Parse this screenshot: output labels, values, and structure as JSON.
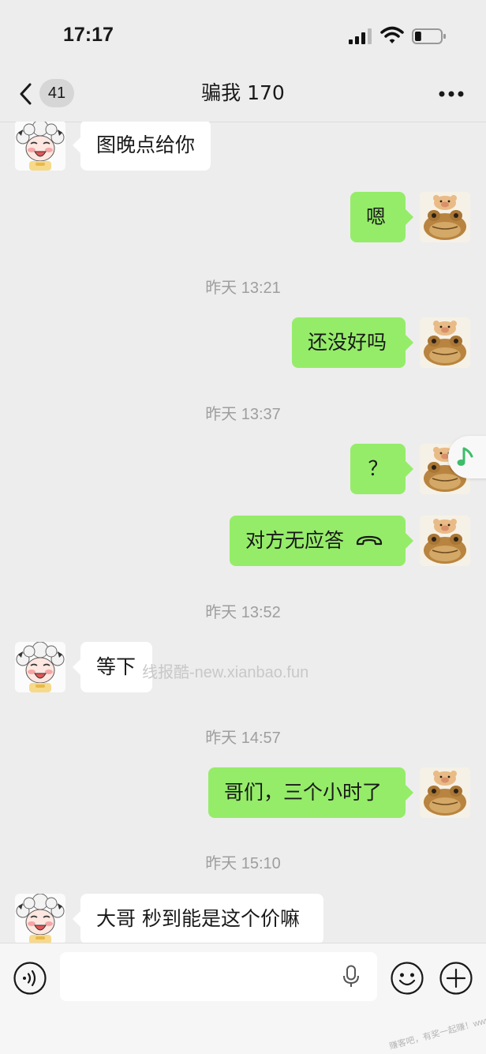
{
  "status_bar": {
    "time": "17:17",
    "battery_level": 0.25
  },
  "header": {
    "back_badge": "41",
    "title": "骗我 170"
  },
  "messages": [
    {
      "type": "text",
      "side": "in",
      "text": "图晚点给你",
      "avatar": "sheep-avatar-icon"
    },
    {
      "type": "text",
      "side": "out",
      "text": "嗯",
      "avatar": "toad-avatar-icon"
    },
    {
      "type": "time",
      "text": "昨天 13:21"
    },
    {
      "type": "text",
      "side": "out",
      "text": "还没好吗",
      "avatar": "toad-avatar-icon"
    },
    {
      "type": "time",
      "text": "昨天 13:37"
    },
    {
      "type": "text",
      "side": "out",
      "text": "？",
      "avatar": "toad-avatar-icon"
    },
    {
      "type": "call",
      "side": "out",
      "text": "对方无应答",
      "icon": "phone-hangup-icon",
      "avatar": "toad-avatar-icon"
    },
    {
      "type": "time",
      "text": "昨天 13:52"
    },
    {
      "type": "text",
      "side": "in",
      "text": "等下",
      "avatar": "sheep-avatar-icon"
    },
    {
      "type": "time",
      "text": "昨天 14:57"
    },
    {
      "type": "text",
      "side": "out",
      "text": "哥们，三个小时了",
      "avatar": "toad-avatar-icon"
    },
    {
      "type": "time",
      "text": "昨天 15:10"
    },
    {
      "type": "text",
      "side": "in",
      "text": "大哥 秒到能是这个价嘛",
      "avatar": "sheep-avatar-icon"
    }
  ],
  "watermark": "线报酷-new.xianbao.fun",
  "corner_watermark": "赚客吧，有奖一起赚！www.zuanke8.com",
  "input_bar": {
    "text_value": "",
    "left_icon": "voice-icon",
    "right_icons": [
      "emoji-icon",
      "plus-icon"
    ]
  },
  "colors": {
    "background": "#ededed",
    "outgoing_bubble": "#95ec69",
    "incoming_bubble": "#ffffff",
    "timestamp": "#9e9e9e"
  }
}
